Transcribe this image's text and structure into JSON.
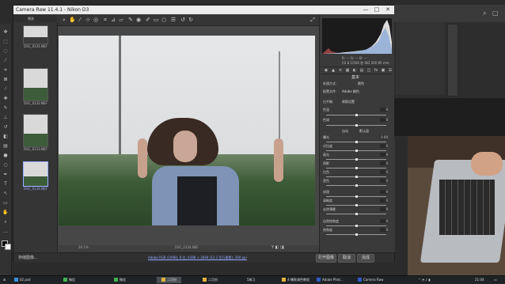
{
  "window": {
    "title": "Camera Raw 11.4.1 - Nikon D3",
    "controls": [
      "—",
      "□",
      "✕"
    ]
  },
  "filmstrip": {
    "header": "筛选",
    "thumbs": [
      {
        "caption": "DSC_0131.NEF",
        "selected": false
      },
      {
        "caption": "DSC_0132.NEF",
        "selected": false
      },
      {
        "caption": "DSC_0133.NEF",
        "selected": false
      },
      {
        "caption": "DSC_0134.NEF",
        "selected": true
      }
    ]
  },
  "toolbar": {
    "tools": [
      "zoom-icon",
      "hand-icon",
      "white-balance-icon",
      "color-sampler-icon",
      "target-adjust-icon",
      "crop-icon",
      "straighten-icon",
      "transform-icon",
      "spot-removal-icon",
      "red-eye-icon",
      "adjustment-brush-icon",
      "graduated-filter-icon",
      "radial-filter-icon",
      "preferences-icon",
      "rotate-left-icon",
      "rotate-right-icon"
    ],
    "right_tools": [
      "fullscreen-icon"
    ]
  },
  "preview": {
    "zoom": "20.1%",
    "filename": "DSC_0134.NEF",
    "compare": "Y ◧ ◨"
  },
  "footer": {
    "save_label": "存储图像...",
    "workflow_text": "Adobe RGB (1998); 8 位; 4288 × 2848 (12.2 百万像素); 300 ppi",
    "open_label": "打开图像",
    "cancel_label": "取消",
    "done_label": "完成"
  },
  "right_panel": {
    "rgb": "R: ---   G: ---   B: ---",
    "exif": "f/2.8   1/500 秒   ISO 200   85 mm",
    "tabs": [
      "◉",
      "▲",
      "≡",
      "▦",
      "◐",
      "▤",
      "◫",
      "fx",
      "▣",
      "☰"
    ],
    "section_title": "基本",
    "rows": [
      {
        "label": "处理方式:",
        "value": "颜色",
        "slider": false
      },
      {
        "label": "配置文件:",
        "value": "Adobe 颜色",
        "slider": false
      },
      {
        "label": "白平衡:",
        "value": "原照设置",
        "slider": false
      },
      {
        "label": "色温",
        "value": "0",
        "slider": true,
        "pos": 0.5
      },
      {
        "label": "色调",
        "value": "0",
        "slider": true,
        "pos": 0.5
      },
      {
        "label": "自动",
        "value": "默认值",
        "slider": false
      },
      {
        "label": "曝光",
        "value": "0.00",
        "slider": true,
        "pos": 0.5
      },
      {
        "label": "对比度",
        "value": "0",
        "slider": true,
        "pos": 0.5
      },
      {
        "label": "高光",
        "value": "0",
        "slider": true,
        "pos": 0.5
      },
      {
        "label": "阴影",
        "value": "0",
        "slider": true,
        "pos": 0.5
      },
      {
        "label": "白色",
        "value": "0",
        "slider": true,
        "pos": 0.5
      },
      {
        "label": "黑色",
        "value": "0",
        "slider": true,
        "pos": 0.5
      },
      {
        "label": "纹理",
        "value": "0",
        "slider": true,
        "pos": 0.5
      },
      {
        "label": "清晰度",
        "value": "0",
        "slider": true,
        "pos": 0.5
      },
      {
        "label": "去除薄雾",
        "value": "0",
        "slider": true,
        "pos": 0.5
      },
      {
        "label": "自然饱和度",
        "value": "0",
        "slider": true,
        "pos": 0.5
      },
      {
        "label": "饱和度",
        "value": "0",
        "slider": true,
        "pos": 0.5
      }
    ]
  },
  "taskbar": {
    "items": [
      {
        "label": "02.psd"
      },
      {
        "label": "微信"
      },
      {
        "label": "微信"
      },
      {
        "label": "二月份",
        "active": true
      },
      {
        "label": "二月份"
      },
      {
        "label": "5练习"
      },
      {
        "label": "4-爆款调色教程"
      },
      {
        "label": "Adobe Phot..."
      },
      {
        "label": "Camera Raw"
      }
    ],
    "clock": "21:04"
  }
}
